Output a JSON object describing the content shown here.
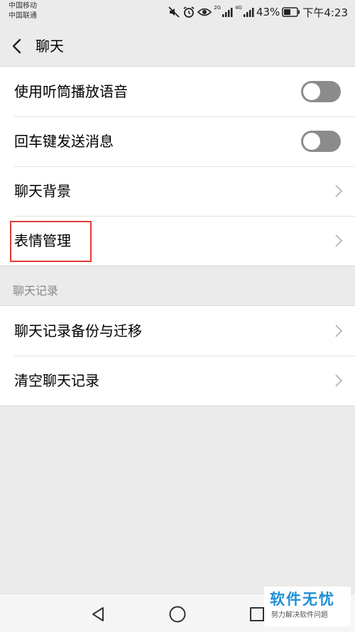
{
  "status_bar": {
    "carrier_1": "中国移动",
    "carrier_2": "中国联通",
    "net_1": "2G",
    "net_2": "4G",
    "battery": "43%",
    "time": "下午4:23"
  },
  "header": {
    "title": "聊天"
  },
  "settings": [
    {
      "label": "使用听筒播放语音",
      "control": "toggle",
      "on": false
    },
    {
      "label": "回车键发送消息",
      "control": "toggle",
      "on": false
    },
    {
      "label": "聊天背景",
      "control": "chevron"
    },
    {
      "label": "表情管理",
      "control": "chevron",
      "highlighted": true
    }
  ],
  "chat_history": {
    "section_label": "聊天记录",
    "items": [
      {
        "label": "聊天记录备份与迁移",
        "control": "chevron"
      },
      {
        "label": "清空聊天记录",
        "control": "chevron"
      }
    ]
  },
  "nav_bar": {
    "icons": [
      "back-triangle-icon",
      "home-circle-icon",
      "recents-square-icon"
    ]
  },
  "watermark": {
    "title": "软件无忧",
    "subtitle": "努力解决软件问题"
  },
  "colors": {
    "background": "#ebebeb",
    "toggle_off": "#8b8b8b",
    "highlight": "#e03b32",
    "watermark": "#1e8fd6"
  }
}
